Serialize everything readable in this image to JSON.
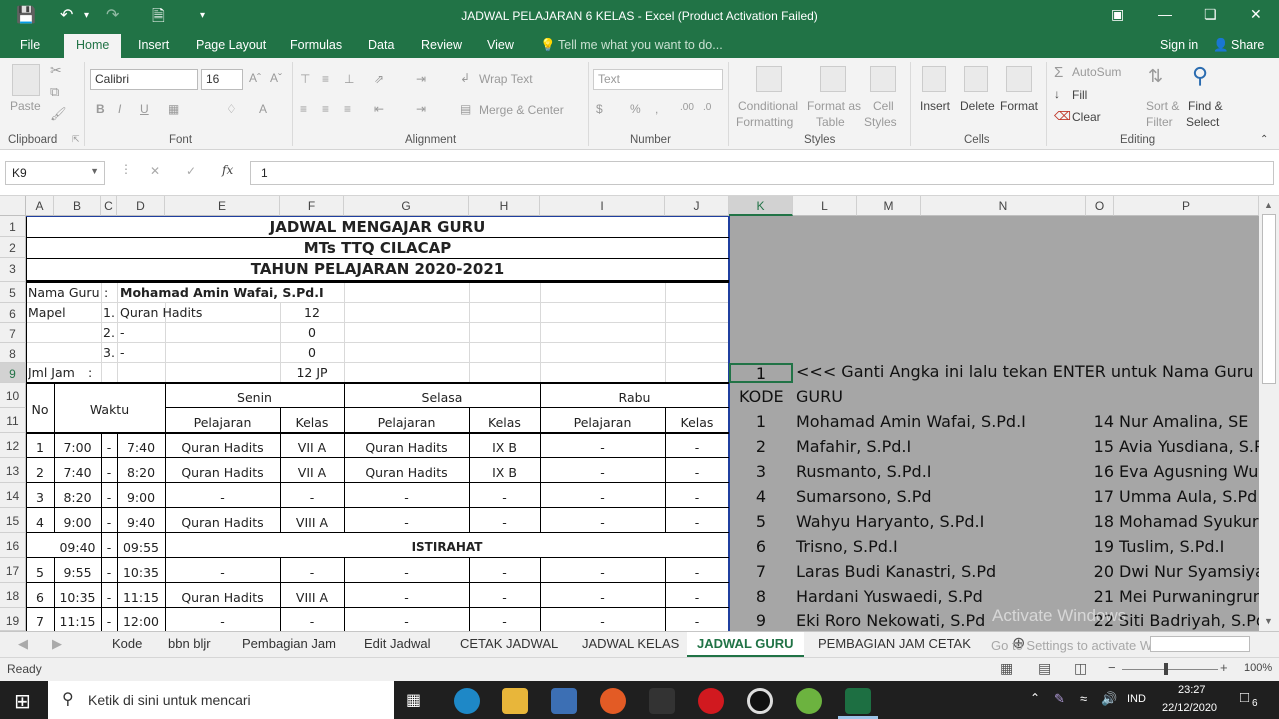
{
  "window": {
    "title": "JADWAL PELAJARAN 6 KELAS - Excel (Product Activation Failed)"
  },
  "ribbon_tabs": [
    "File",
    "Home",
    "Insert",
    "Page Layout",
    "Formulas",
    "Data",
    "Review",
    "View"
  ],
  "tell_me": "Tell me what you want to do...",
  "signin": "Sign in",
  "share": "Share",
  "ribbon": {
    "clipboard": {
      "label": "Clipboard",
      "paste": "Paste"
    },
    "font": {
      "label": "Font",
      "name": "Calibri",
      "size": "16",
      "bold": "B",
      "italic": "I",
      "underline": "U"
    },
    "alignment": {
      "label": "Alignment",
      "wrap": "Wrap Text",
      "merge": "Merge & Center"
    },
    "number": {
      "label": "Number",
      "format": "Text"
    },
    "styles": {
      "label": "Styles",
      "cond": "Conditional",
      "cond2": "Formatting",
      "fmt": "Format as",
      "fmt2": "Table",
      "cell": "Cell",
      "cell2": "Styles"
    },
    "cells": {
      "label": "Cells",
      "insert": "Insert",
      "delete": "Delete",
      "format": "Format"
    },
    "editing": {
      "label": "Editing",
      "autosum": "AutoSum",
      "fill": "Fill",
      "clear": "Clear",
      "sort": "Sort &",
      "sort2": "Filter",
      "find": "Find &",
      "find2": "Select"
    }
  },
  "formula_bar": {
    "name_box": "K9",
    "fx": "fx",
    "value": "1"
  },
  "columns": [
    "A",
    "B",
    "C",
    "D",
    "E",
    "F",
    "G",
    "H",
    "I",
    "J",
    "K",
    "L",
    "M",
    "N",
    "O",
    "P"
  ],
  "rows": [
    "1",
    "2",
    "3",
    "5",
    "6",
    "7",
    "8",
    "9",
    "10",
    "11",
    "12",
    "13",
    "14",
    "15",
    "16",
    "17",
    "18",
    "19"
  ],
  "sheet": {
    "title1": "JADWAL MENGAJAR GURU",
    "title2": "MTs TTQ CILACAP",
    "title3": "TAHUN PELAJARAN 2020-2021",
    "nama_label": "Nama Guru",
    "colon": ":",
    "nama": "Mohamad Amin Wafai, S.Pd.I",
    "mapel_label": "Mapel",
    "mapel": [
      {
        "no": "1.",
        "name": "Quran Hadits",
        "jam": "12"
      },
      {
        "no": "2.",
        "name": "-",
        "jam": "0"
      },
      {
        "no": "3.",
        "name": "-",
        "jam": "0"
      }
    ],
    "jml_label": "Jml Jam",
    "jml": "12 JP",
    "hdr": {
      "no": "No",
      "waktu": "Waktu",
      "senin": "Senin",
      "selasa": "Selasa",
      "rabu": "Rabu",
      "pelajaran": "Pelajaran",
      "kelas": "Kelas"
    },
    "istirahat": "ISTIRAHAT",
    "schedule": [
      {
        "no": "1",
        "start": "7:00",
        "dash": "-",
        "end": "7:40",
        "p1": "Quran Hadits",
        "k1": "VII A",
        "p2": "Quran Hadits",
        "k2": "IX B",
        "p3": "-",
        "k3": "-"
      },
      {
        "no": "2",
        "start": "7:40",
        "dash": "-",
        "end": "8:20",
        "p1": "Quran Hadits",
        "k1": "VII A",
        "p2": "Quran Hadits",
        "k2": "IX B",
        "p3": "-",
        "k3": "-"
      },
      {
        "no": "3",
        "start": "8:20",
        "dash": "-",
        "end": "9:00",
        "p1": "-",
        "k1": "-",
        "p2": "-",
        "k2": "-",
        "p3": "-",
        "k3": "-"
      },
      {
        "no": "4",
        "start": "9:00",
        "dash": "-",
        "end": "9:40",
        "p1": "Quran Hadits",
        "k1": "VIII A",
        "p2": "-",
        "k2": "-",
        "p3": "-",
        "k3": "-"
      },
      {
        "no": "",
        "start": "09:40",
        "dash": "-",
        "end": "09:55",
        "p1": "",
        "k1": "",
        "p2": "",
        "k2": "",
        "p3": "",
        "k3": ""
      },
      {
        "no": "5",
        "start": "9:55",
        "dash": "-",
        "end": "10:35",
        "p1": "-",
        "k1": "-",
        "p2": "-",
        "k2": "-",
        "p3": "-",
        "k3": "-"
      },
      {
        "no": "6",
        "start": "10:35",
        "dash": "-",
        "end": "11:15",
        "p1": "Quran Hadits",
        "k1": "VIII A",
        "p2": "-",
        "k2": "-",
        "p3": "-",
        "k3": "-"
      },
      {
        "no": "7",
        "start": "11:15",
        "dash": "-",
        "end": "12:00",
        "p1": "-",
        "k1": "-",
        "p2": "-",
        "k2": "-",
        "p3": "-",
        "k3": "-"
      }
    ]
  },
  "side": {
    "input_value": "1",
    "hint": "<<< Ganti Angka ini lalu tekan ENTER untuk Nama Guru yang",
    "kode": "KODE",
    "guru": "GURU",
    "list_left": [
      {
        "k": "1",
        "n": "Mohamad Amin Wafai, S.Pd.I"
      },
      {
        "k": "2",
        "n": "Mafahir, S.Pd.I"
      },
      {
        "k": "3",
        "n": "Rusmanto, S.Pd.I"
      },
      {
        "k": "4",
        "n": "Sumarsono, S.Pd"
      },
      {
        "k": "5",
        "n": "Wahyu Haryanto, S.Pd.I"
      },
      {
        "k": "6",
        "n": "Trisno, S.Pd.I"
      },
      {
        "k": "7",
        "n": "Laras Budi Kanastri, S.Pd"
      },
      {
        "k": "8",
        "n": "Hardani Yuswaedi, S.Pd"
      },
      {
        "k": "9",
        "n": "Eki Roro Nekowati, S.Pd"
      }
    ],
    "list_right": [
      {
        "k": "14",
        "n": "Nur Amalina, SE"
      },
      {
        "k": "15",
        "n": "Avia Yusdiana, S.P"
      },
      {
        "k": "16",
        "n": "Eva Agusning Wul"
      },
      {
        "k": "17",
        "n": "Umma Aula, S.Pd."
      },
      {
        "k": "18",
        "n": "Mohamad Syukur,"
      },
      {
        "k": "19",
        "n": "Tuslim, S.Pd.I"
      },
      {
        "k": "20",
        "n": "Dwi Nur Syamsiya"
      },
      {
        "k": "21",
        "n": "Mei Purwaningrun"
      },
      {
        "k": "22",
        "n": "Siti Badriyah, S.Pd"
      }
    ]
  },
  "sheet_tabs": [
    "Kode",
    "bbn bljr",
    "Pembagian Jam",
    "Edit Jadwal",
    "CETAK JADWAL",
    "JADWAL KELAS",
    "JADWAL GURU",
    "PEMBAGIAN JAM CETAK"
  ],
  "active_sheet": "JADWAL GURU",
  "watermark": {
    "line1": "Activate Windows",
    "line2": "Go to Settings to activate Windows."
  },
  "status": {
    "ready": "Ready",
    "zoom": "100%"
  },
  "taskbar": {
    "search": "Ketik di sini untuk mencari",
    "lang": "IND",
    "time": "23:27",
    "date": "22/12/2020",
    "notif": "6"
  }
}
